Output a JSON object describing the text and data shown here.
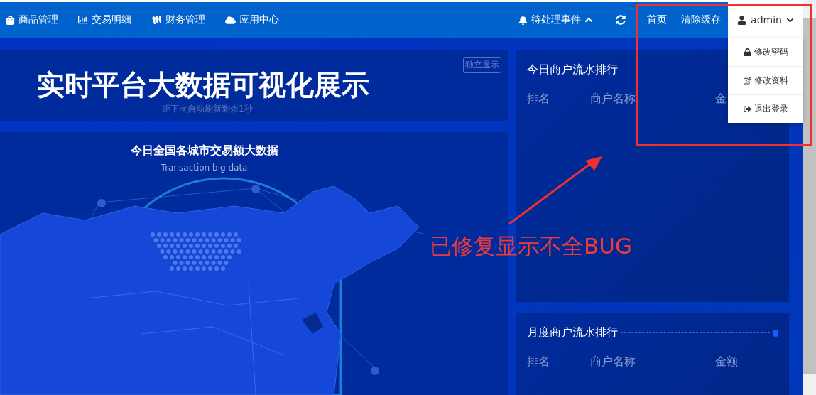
{
  "nav_left": [
    {
      "label": "商品管理",
      "kind": "goods"
    },
    {
      "label": "交易明细",
      "kind": "transactions"
    },
    {
      "label": "财务管理",
      "kind": "finance"
    },
    {
      "label": "应用中心",
      "kind": "apps"
    }
  ],
  "nav_right": {
    "events": "待处理事件",
    "links": [
      "首页",
      "清除缓存"
    ],
    "user": {
      "label": "admin",
      "expanded": true
    }
  },
  "user_menu": [
    {
      "label": "修改密码",
      "kind": "password"
    },
    {
      "label": "修改资料",
      "kind": "profile"
    },
    {
      "label": "退出登录",
      "kind": "logout"
    }
  ],
  "headline": {
    "title": "实时平台大数据可视化展示",
    "button": "独立显示",
    "countdown": "距下次自动刷新剩余1秒"
  },
  "map_panel": {
    "title": "今日全国各城市交易额大数据",
    "subtitle": "Transaction big data"
  },
  "rank_panels": [
    {
      "title": "今日商户流水排行",
      "columns": [
        "排名",
        "商户名称",
        "金"
      ]
    },
    {
      "title": "月度商户流水排行",
      "columns": [
        "排名",
        "商户名称",
        "金额"
      ]
    }
  ],
  "annotation": {
    "text": "已修复显示不全BUG"
  }
}
